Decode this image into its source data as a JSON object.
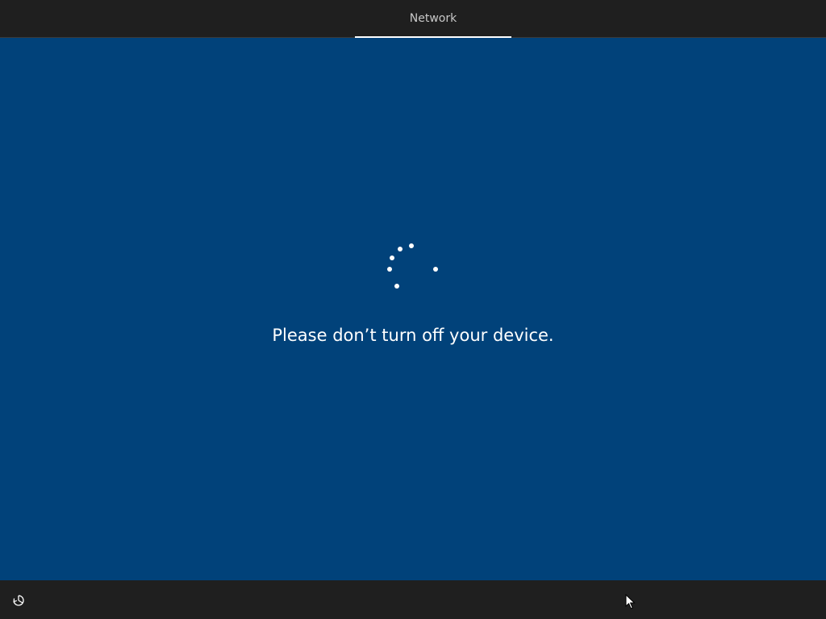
{
  "header": {
    "tabs": [
      {
        "label": "Network",
        "selected": true
      }
    ]
  },
  "main": {
    "message": "Please don’t turn off your device.",
    "spinner_icon": "loading-spinner-icon"
  },
  "footer": {
    "accessibility_icon": "ease-of-access-icon"
  },
  "colors": {
    "background": "#01427a",
    "bars": "#1f1f1f",
    "text": "#ffffff",
    "tab_text": "#c8c8c8"
  }
}
